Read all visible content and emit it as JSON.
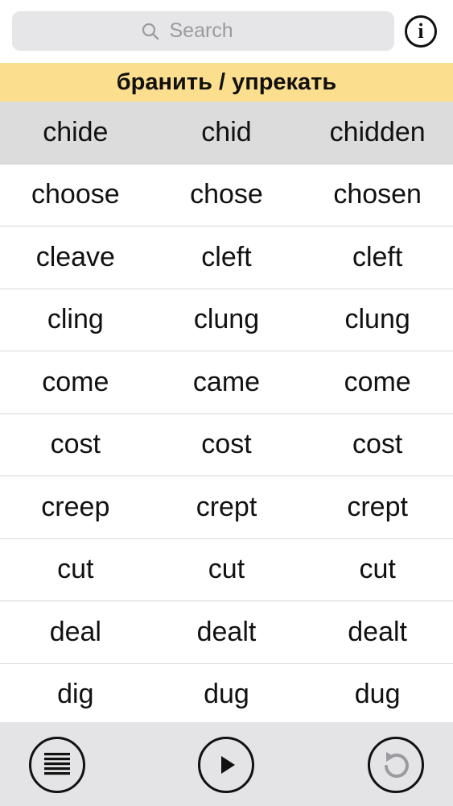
{
  "search": {
    "placeholder": "Search"
  },
  "info": {
    "label": "i"
  },
  "translation": "бранить / упрекать",
  "verbs": [
    [
      "chide",
      "chid",
      "chidden"
    ],
    [
      "choose",
      "chose",
      "chosen"
    ],
    [
      "cleave",
      "cleft",
      "cleft"
    ],
    [
      "cling",
      "clung",
      "clung"
    ],
    [
      "come",
      "came",
      "come"
    ],
    [
      "cost",
      "cost",
      "cost"
    ],
    [
      "creep",
      "crept",
      "crept"
    ],
    [
      "cut",
      "cut",
      "cut"
    ],
    [
      "deal",
      "dealt",
      "dealt"
    ],
    [
      "dig",
      "dug",
      "dug"
    ]
  ],
  "selected_index": 0,
  "toolbar": {
    "icons": [
      "list-icon",
      "play-icon",
      "repeat-icon"
    ]
  },
  "colors": {
    "translation_bg": "#fbdf8e",
    "selected_row_bg": "#dcdcdc",
    "toolbar_bg": "#e4e4e6",
    "search_bg": "#e6e6e8"
  }
}
